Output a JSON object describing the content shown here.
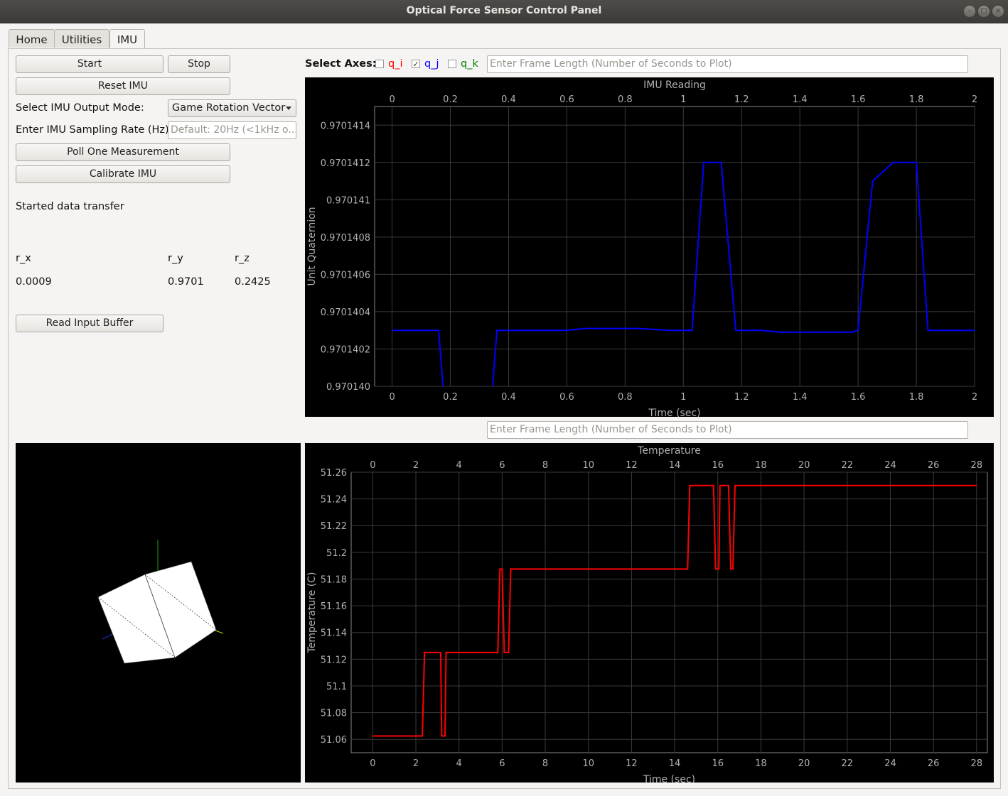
{
  "window": {
    "title": "Optical Force Sensor Control Panel"
  },
  "tabs": [
    {
      "label": "Home",
      "active": false
    },
    {
      "label": "Utilities",
      "active": false
    },
    {
      "label": "IMU",
      "active": true
    }
  ],
  "controls": {
    "start_label": "Start",
    "stop_label": "Stop",
    "reset_label": "Reset IMU",
    "mode_label": "Select IMU Output Mode:",
    "mode_value": "Game Rotation Vector",
    "rate_label": "Enter IMU Sampling Rate (Hz):",
    "rate_placeholder": "Default: 20Hz (<1kHz o...",
    "poll_label": "Poll One Measurement",
    "calibrate_label": "Calibrate IMU",
    "status_text": "Started data transfer",
    "read_buffer_label": "Read Input Buffer"
  },
  "readings": {
    "headers": [
      "r_x",
      "r_y",
      "r_z"
    ],
    "values": [
      "0.0009",
      "0.9701",
      "0.2425"
    ]
  },
  "axes_select": {
    "label": "Select Axes:",
    "items": [
      {
        "label": "q_i",
        "checked": false,
        "color": "#ff0000"
      },
      {
        "label": "q_j",
        "checked": true,
        "color": "#0000ff"
      },
      {
        "label": "q_k",
        "checked": false,
        "color": "#008000"
      }
    ],
    "frame_placeholder": "Enter Frame Length (Number of Seconds to Plot)"
  },
  "temp_controls": {
    "frame_placeholder": "Enter Frame Length (Number of Seconds to Plot)"
  },
  "colors": {
    "imu_line": "#0000ff",
    "temp_line": "#ff0000",
    "plot_bg": "#000000",
    "axis_text": "#b0b0b0"
  },
  "chart_data": [
    {
      "type": "line",
      "title": "IMU Reading",
      "xlabel": "Time (sec)",
      "ylabel": "Unit Quaternion",
      "xlim": [
        -0.06,
        2.0
      ],
      "ylim": [
        0.97014,
        0.9701415
      ],
      "x_ticks": [
        "0",
        "0.2",
        "0.4",
        "0.6",
        "0.8",
        "1",
        "1.2",
        "1.4",
        "1.6",
        "1.8",
        "2"
      ],
      "y_ticks": [
        "0.970140",
        "0.9701402",
        "0.9701404",
        "0.9701406",
        "0.9701408",
        "0.970141",
        "0.9701412",
        "0.9701414"
      ],
      "grid": true,
      "series": [
        {
          "x": [
            0,
            0.15,
            0.16,
            0.18,
            0.34,
            0.36,
            0.45,
            0.6,
            0.66,
            0.7,
            0.8,
            0.85,
            0.95,
            1.03,
            1.07,
            1.13,
            1.18,
            1.27,
            1.33,
            1.4,
            1.58,
            1.6,
            1.65,
            1.72,
            1.8,
            1.84,
            2.0
          ],
          "y": [
            0.9701403,
            0.9701403,
            0.9701403,
            0.9701399,
            0.9701399,
            0.9701403,
            0.9701403,
            0.9701403,
            0.97014031,
            0.97014031,
            0.97014031,
            0.97014031,
            0.9701403,
            0.9701403,
            0.9701412,
            0.9701412,
            0.9701403,
            0.9701403,
            0.97014029,
            0.97014029,
            0.97014029,
            0.9701403,
            0.9701411,
            0.9701412,
            0.9701412,
            0.9701403,
            0.9701403
          ]
        }
      ]
    },
    {
      "type": "line",
      "title": "Temperature",
      "xlabel": "Time (sec)",
      "ylabel": "Temperature (C)",
      "xlim": [
        -1,
        28.5
      ],
      "ylim": [
        51.05,
        51.26
      ],
      "x_ticks": [
        "0",
        "2",
        "4",
        "6",
        "8",
        "10",
        "12",
        "14",
        "16",
        "18",
        "20",
        "22",
        "24",
        "26",
        "28"
      ],
      "y_ticks": [
        "51.06",
        "51.08",
        "51.1",
        "51.12",
        "51.14",
        "51.16",
        "51.18",
        "51.2",
        "51.22",
        "51.24",
        "51.26"
      ],
      "grid": true,
      "series": [
        {
          "x": [
            0,
            2.3,
            2.4,
            3.15,
            3.2,
            3.35,
            3.4,
            5.8,
            5.9,
            6.0,
            6.1,
            6.3,
            6.4,
            14.6,
            14.7,
            15.8,
            15.9,
            16.05,
            16.1,
            16.5,
            16.6,
            16.7,
            16.8,
            28.0
          ],
          "y": [
            51.0625,
            51.0625,
            51.125,
            51.125,
            51.0625,
            51.0625,
            51.125,
            51.125,
            51.1875,
            51.1875,
            51.125,
            51.125,
            51.1875,
            51.1875,
            51.25,
            51.25,
            51.1875,
            51.1875,
            51.25,
            51.25,
            51.1875,
            51.1875,
            51.25,
            51.25
          ]
        }
      ]
    }
  ]
}
